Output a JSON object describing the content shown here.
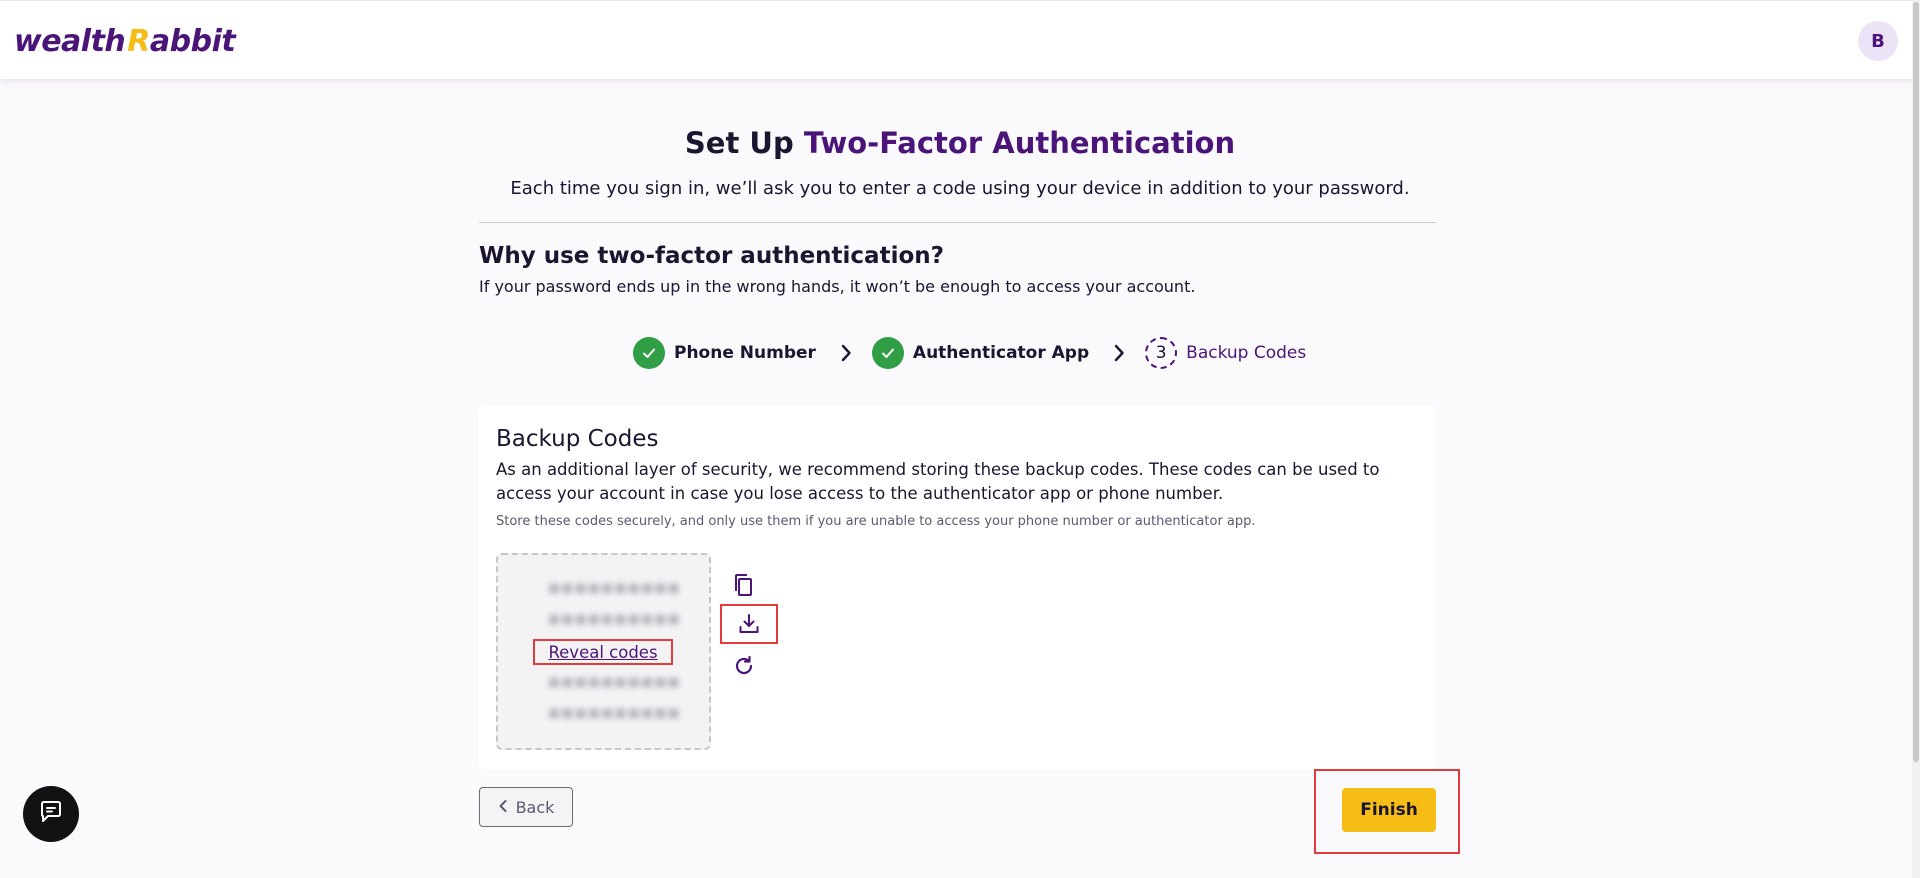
{
  "header": {
    "logo_text_main": "wealth",
    "logo_text_accent": "Rabbit",
    "avatar_initial": "B"
  },
  "page": {
    "title_prefix": "Set Up",
    "title_accent": "Two-Factor Authentication",
    "subtitle": "Each time you sign in, we’ll ask you to enter a code using your device in addition to your password.",
    "why_title": "Why use two-factor authentication?",
    "why_desc": "If your password ends up in the wrong hands, it won’t be enough to access your account."
  },
  "stepper": {
    "steps": [
      {
        "label": "Phone Number",
        "status": "done"
      },
      {
        "label": "Authenticator App",
        "status": "done"
      },
      {
        "label": "Backup Codes",
        "status": "current",
        "number": "3"
      }
    ]
  },
  "card": {
    "title": "Backup Codes",
    "description": "As an additional layer of security, we recommend storing these backup codes. These codes can be used to access your account in case you lose access to the authenticator app or phone number.",
    "note": "Store these codes securely, and only use them if you are unable to access your phone number or authenticator app.",
    "reveal_label": "Reveal codes",
    "actions": [
      "copy-icon",
      "download-icon",
      "refresh-icon"
    ]
  },
  "buttons": {
    "back_label": "Back",
    "finish_label": "Finish"
  },
  "colors": {
    "brand_purple": "#4b1478",
    "brand_yellow": "#f6bd16",
    "success_green": "#2f9e44",
    "highlight_red": "#e23b3b"
  }
}
